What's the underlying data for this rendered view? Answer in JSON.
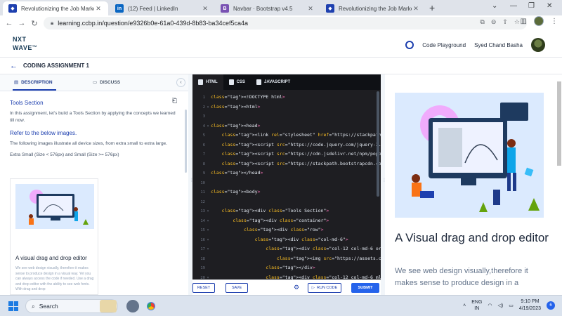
{
  "browser": {
    "tabs": [
      {
        "title": "Revolutionizing the Job Market |",
        "favicon": "ccbp-icon",
        "active": true
      },
      {
        "title": "(12) Feed | LinkedIn",
        "favicon": "linkedin-icon",
        "active": false
      },
      {
        "title": "Navbar · Bootstrap v4.5",
        "favicon": "bootstrap-icon",
        "active": false
      },
      {
        "title": "Revolutionizing the Job Market |",
        "favicon": "ccbp-icon",
        "active": false
      }
    ],
    "url": "learning.ccbp.in/question/e9326b0e-61a0-439d-8b83-ba34cef5ca4a"
  },
  "header": {
    "logo_line1": "NXT",
    "logo_line2": "WAVE",
    "logo_suffix": "TM",
    "playground_label": "Code Playground",
    "user_name": "Syed Chand Basha"
  },
  "assignment": {
    "title": "CODING ASSIGNMENT 1"
  },
  "left": {
    "tab_description": "DESCRIPTION",
    "tab_discuss": "DISCUSS",
    "section_title": "Tools Section",
    "intro": "In this assignment, let's build a Tools Section by applying the concepts we learned till now.",
    "refer_heading": "Refer to the below images.",
    "sizes_text": "The following images illustrate all device sizes, from extra small to extra large.",
    "sizes_label": "Extra Small (Size < 576px) and Small (Size >= 576px)",
    "card_title": "A visual drag and drop editor",
    "card_text": "We see web design visually, therefore it makes sense to produce design in a visual way. Yet you can always access the code if needed. Use a drag and drop editor with the ability to see web fonts. With drag and drop"
  },
  "editor": {
    "tabs": [
      "HTML",
      "CSS",
      "JAVASCRIPT"
    ],
    "lines": [
      {
        "n": "1",
        "fold": "",
        "indent": "",
        "text": "<!DOCTYPE html>"
      },
      {
        "n": "2",
        "fold": "▾",
        "indent": "",
        "text": "<html>"
      },
      {
        "n": "3",
        "fold": "",
        "indent": "",
        "text": ""
      },
      {
        "n": "4",
        "fold": "▾",
        "indent": "",
        "text": "<head>"
      },
      {
        "n": "5",
        "fold": "",
        "indent": "    ",
        "text": "<link rel=\"stylesheet\" href=\"https://stackpath.boots"
      },
      {
        "n": "6",
        "fold": "",
        "indent": "    ",
        "text": "<script src=\"https://code.jquery.com/jquery-3.5.1.sl"
      },
      {
        "n": "7",
        "fold": "",
        "indent": "    ",
        "text": "<script src=\"https://cdn.jsdelivr.net/npm/popper.js@"
      },
      {
        "n": "8",
        "fold": "",
        "indent": "    ",
        "text": "<script src=\"https://stackpath.bootstrapcdn.com/boot"
      },
      {
        "n": "9",
        "fold": "",
        "indent": "",
        "text": "</head>"
      },
      {
        "n": "10",
        "fold": "",
        "indent": "",
        "text": ""
      },
      {
        "n": "11",
        "fold": "",
        "indent": "",
        "text": "<body>"
      },
      {
        "n": "12",
        "fold": "",
        "indent": "",
        "text": ""
      },
      {
        "n": "13",
        "fold": "▾",
        "indent": "    ",
        "text": "<div class=\"Tools Section\">"
      },
      {
        "n": "14",
        "fold": "▾",
        "indent": "        ",
        "text": "<div class=\"container\">"
      },
      {
        "n": "15",
        "fold": "▾",
        "indent": "            ",
        "text": "<div class=\"row\">"
      },
      {
        "n": "16",
        "fold": "▾",
        "indent": "                ",
        "text": "<div class=\"col-md-6\">"
      },
      {
        "n": "17",
        "fold": "▾",
        "indent": "                    ",
        "text": "<div class=\"col-12 col-md-6 order-3"
      },
      {
        "n": "18",
        "fold": "",
        "indent": "                        ",
        "text": "<img src=\"https://assets.ccbp.in"
      },
      {
        "n": "19",
        "fold": "",
        "indent": "                    ",
        "text": "</div>"
      },
      {
        "n": "20",
        "fold": "▾",
        "indent": "                    ",
        "text": "<div class=\"col-12 col-md-6 ml-4 mb-"
      }
    ],
    "reset_label": "RESET",
    "save_label": "SAVE",
    "run_label": "RUN CODE",
    "submit_label": "SUBMIT"
  },
  "output": {
    "title": "A Visual drag and drop editor",
    "text": "We see web design visually,therefore it makes sense to produce design in a"
  },
  "taskbar": {
    "search_placeholder": "Search",
    "lang_line1": "ENG",
    "lang_line2": "IN",
    "time": "9:10 PM",
    "date": "4/19/2023",
    "notifications": "6"
  },
  "colors": {
    "accent": "#1e40af",
    "editor_bg": "#1e1e22",
    "submit": "#2563eb"
  }
}
